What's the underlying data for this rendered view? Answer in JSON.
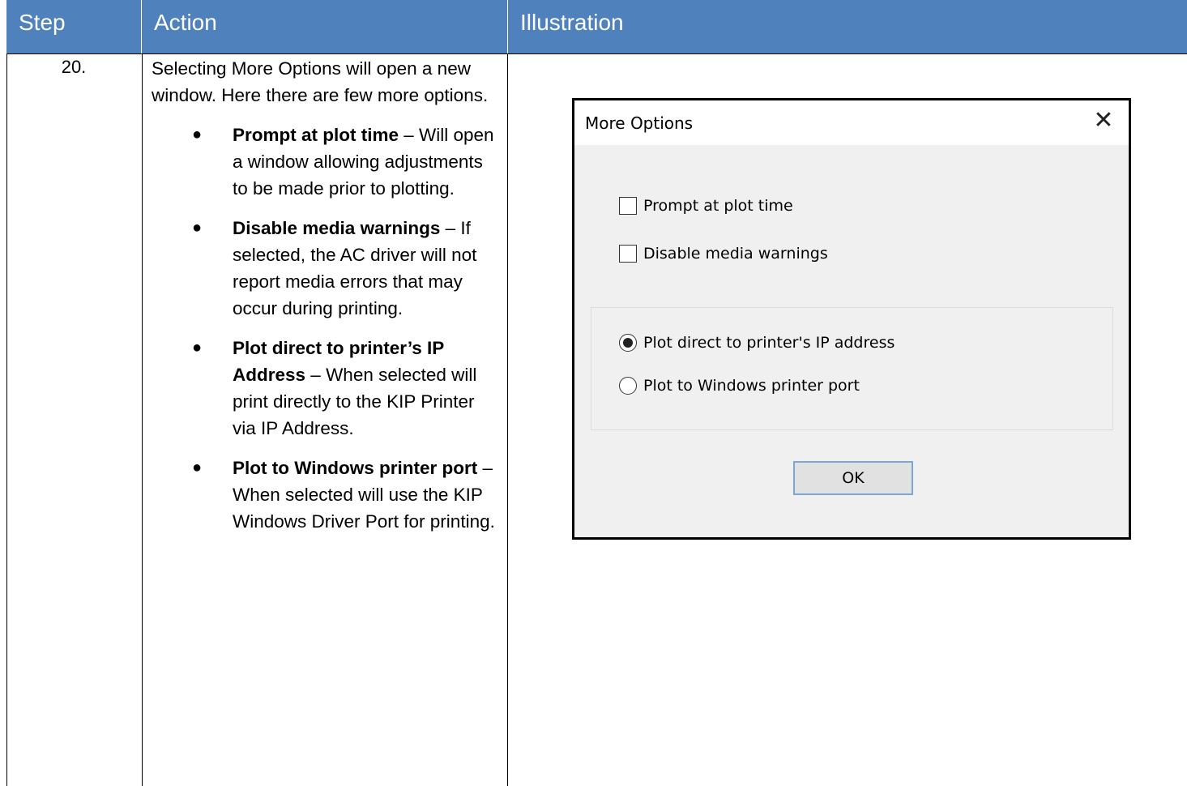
{
  "header": {
    "col_step": "Step",
    "col_action": "Action",
    "col_illustration": "Illustration"
  },
  "row": {
    "step": "20.",
    "intro": "Selecting More Options will open a new window. Here there are few more options.",
    "bullets": [
      {
        "term": "Prompt at plot time",
        "desc": " – Will open a window allowing adjustments to be made prior to plotting."
      },
      {
        "term": "Disable media warnings",
        "desc": " – If selected, the AC driver will not report media errors that may occur during printing."
      },
      {
        "term": "Plot direct to printer’s IP Address",
        "desc": " – When selected will print directly to the KIP Printer via IP Address."
      },
      {
        "term": "Plot to Windows printer port",
        "desc": " – When selected will use the KIP Windows Driver Port for printing."
      }
    ]
  },
  "dialog": {
    "title": "More Options",
    "close_glyph": "✕",
    "checkbox_prompt": "Prompt at plot time",
    "checkbox_media": "Disable media warnings",
    "radio_ip": "Plot direct to printer's IP address",
    "radio_port": "Plot to Windows printer port",
    "ok_label": "OK",
    "prompt_checked": false,
    "media_checked": false,
    "selected_radio": "radio_ip"
  },
  "colors": {
    "header_bg": "#4f81bd",
    "header_text": "#ffffff",
    "dialog_bg": "#f0f0f0",
    "ok_border": "#7aa7d6"
  }
}
